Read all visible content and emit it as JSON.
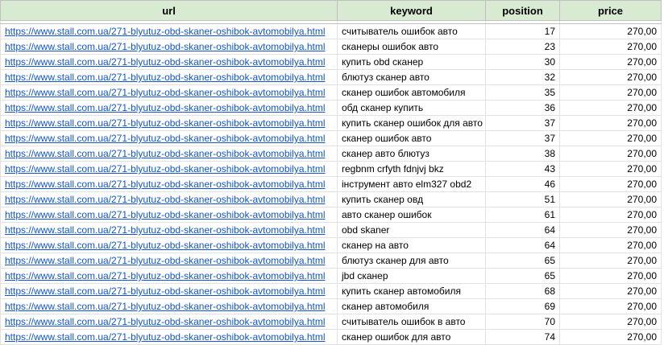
{
  "headers": {
    "url": "url",
    "keyword": "keyword",
    "position": "position",
    "price": "price"
  },
  "rows": [
    {
      "url": "https://www.stall.com.ua/271-blyutuz-obd-skaner-oshibok-avtomobilya.html",
      "keyword": "считыватель ошибок авто",
      "position": "17",
      "price": "270,00"
    },
    {
      "url": "https://www.stall.com.ua/271-blyutuz-obd-skaner-oshibok-avtomobilya.html",
      "keyword": "сканеры ошибок авто",
      "position": "23",
      "price": "270,00"
    },
    {
      "url": "https://www.stall.com.ua/271-blyutuz-obd-skaner-oshibok-avtomobilya.html",
      "keyword": "купить obd сканер",
      "position": "30",
      "price": "270,00"
    },
    {
      "url": "https://www.stall.com.ua/271-blyutuz-obd-skaner-oshibok-avtomobilya.html",
      "keyword": "блютуз сканер авто",
      "position": "32",
      "price": "270,00"
    },
    {
      "url": "https://www.stall.com.ua/271-blyutuz-obd-skaner-oshibok-avtomobilya.html",
      "keyword": "сканер ошибок автомобиля",
      "position": "35",
      "price": "270,00"
    },
    {
      "url": "https://www.stall.com.ua/271-blyutuz-obd-skaner-oshibok-avtomobilya.html",
      "keyword": "обд сканер купить",
      "position": "36",
      "price": "270,00"
    },
    {
      "url": "https://www.stall.com.ua/271-blyutuz-obd-skaner-oshibok-avtomobilya.html",
      "keyword": "купить сканер ошибок для авто",
      "position": "37",
      "price": "270,00"
    },
    {
      "url": "https://www.stall.com.ua/271-blyutuz-obd-skaner-oshibok-avtomobilya.html",
      "keyword": "сканер ошибок авто",
      "position": "37",
      "price": "270,00"
    },
    {
      "url": "https://www.stall.com.ua/271-blyutuz-obd-skaner-oshibok-avtomobilya.html",
      "keyword": "сканер авто блютуз",
      "position": "38",
      "price": "270,00"
    },
    {
      "url": "https://www.stall.com.ua/271-blyutuz-obd-skaner-oshibok-avtomobilya.html",
      "keyword": "regbnm crfyth fdnjvj bkz",
      "position": "43",
      "price": "270,00"
    },
    {
      "url": "https://www.stall.com.ua/271-blyutuz-obd-skaner-oshibok-avtomobilya.html",
      "keyword": "інструмент авто elm327 obd2",
      "position": "46",
      "price": "270,00"
    },
    {
      "url": "https://www.stall.com.ua/271-blyutuz-obd-skaner-oshibok-avtomobilya.html",
      "keyword": "купить сканер овд",
      "position": "51",
      "price": "270,00"
    },
    {
      "url": "https://www.stall.com.ua/271-blyutuz-obd-skaner-oshibok-avtomobilya.html",
      "keyword": "авто сканер ошибок",
      "position": "61",
      "price": "270,00"
    },
    {
      "url": "https://www.stall.com.ua/271-blyutuz-obd-skaner-oshibok-avtomobilya.html",
      "keyword": "obd skaner",
      "position": "64",
      "price": "270,00"
    },
    {
      "url": "https://www.stall.com.ua/271-blyutuz-obd-skaner-oshibok-avtomobilya.html",
      "keyword": "сканер на авто",
      "position": "64",
      "price": "270,00"
    },
    {
      "url": "https://www.stall.com.ua/271-blyutuz-obd-skaner-oshibok-avtomobilya.html",
      "keyword": "блютуз сканер для авто",
      "position": "65",
      "price": "270,00"
    },
    {
      "url": "https://www.stall.com.ua/271-blyutuz-obd-skaner-oshibok-avtomobilya.html",
      "keyword": "jbd сканер",
      "position": "65",
      "price": "270,00"
    },
    {
      "url": "https://www.stall.com.ua/271-blyutuz-obd-skaner-oshibok-avtomobilya.html",
      "keyword": "купить сканер автомобиля",
      "position": "68",
      "price": "270,00"
    },
    {
      "url": "https://www.stall.com.ua/271-blyutuz-obd-skaner-oshibok-avtomobilya.html",
      "keyword": "сканер автомобиля",
      "position": "69",
      "price": "270,00"
    },
    {
      "url": "https://www.stall.com.ua/271-blyutuz-obd-skaner-oshibok-avtomobilya.html",
      "keyword": "считыватель ошибок в авто",
      "position": "70",
      "price": "270,00"
    },
    {
      "url": "https://www.stall.com.ua/271-blyutuz-obd-skaner-oshibok-avtomobilya.html",
      "keyword": "сканер ошибок для авто",
      "position": "74",
      "price": "270,00"
    }
  ]
}
